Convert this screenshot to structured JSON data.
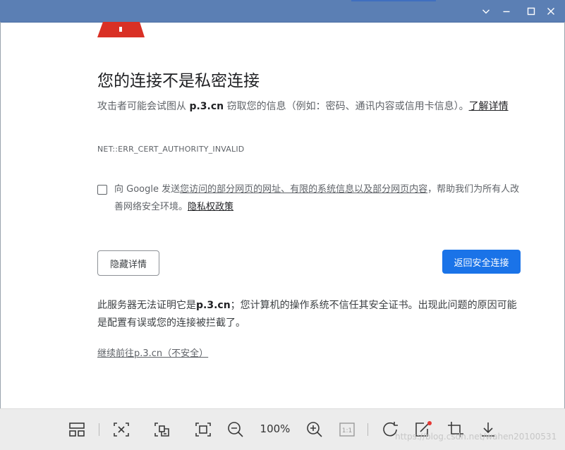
{
  "window": {
    "minimize_icon": "chevron-down-icon",
    "restore_icon": "minimize-icon",
    "maximize_icon": "maximize-icon",
    "close_icon": "close-icon"
  },
  "interstitial": {
    "heading": "您的连接不是私密连接",
    "explanation_before": "攻击者可能会试图从 ",
    "host": "p.3.cn",
    "explanation_after": " 窃取您的信息（例如：密码、通讯内容或信用卡信息）。",
    "learn_more": "了解详情",
    "error_code": "NET::ERR_CERT_AUTHORITY_INVALID",
    "optin_before": "向 Google 发送",
    "optin_link": "您访问的部分网页的网址、有限的系统信息以及部分网页内容",
    "optin_after": "，帮助我们为所有人改善网络安全环境。",
    "privacy_link": "隐私权政策",
    "details_button": "隐藏详情",
    "back_button": "返回安全连接",
    "details_before": "此服务器无法证明它是",
    "details_host": "p.3.cn",
    "details_after": "；您计算机的操作系统不信任其安全证书。出现此问题的原因可能是配置有误或您的连接被拦截了。",
    "proceed_link": "继续前往p.3.cn（不安全）",
    "accent_color": "#1a73e8",
    "warning_color": "#d93025"
  },
  "toolbar": {
    "zoom": "100%",
    "actual_size": "1:1",
    "watermark": "https://blog.csdn.net/wahen20100531"
  }
}
